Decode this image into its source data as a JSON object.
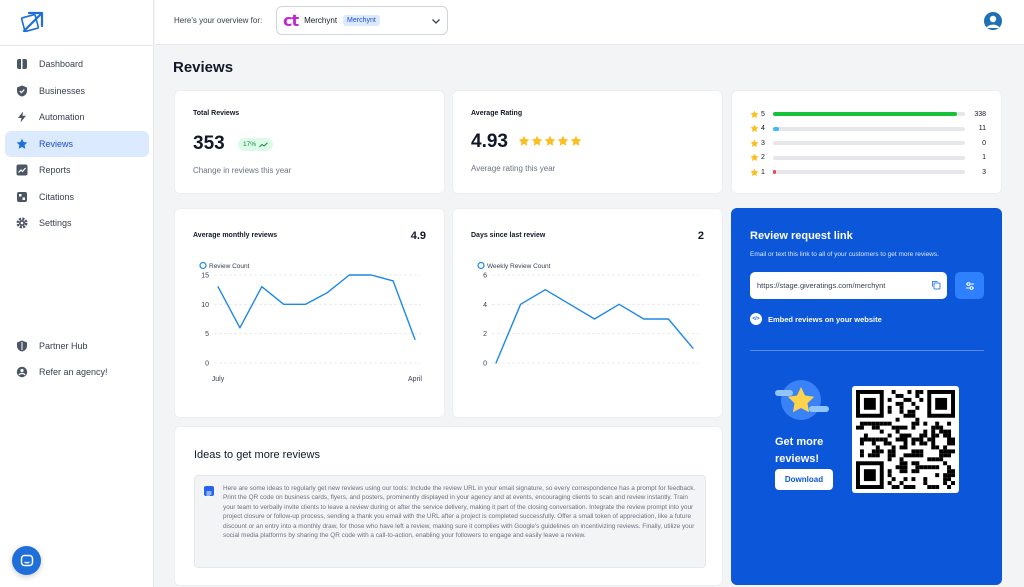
{
  "header": {
    "overview_label": "Here's your overview for:",
    "business_name": "Merchynt",
    "business_tag": "Merchynt",
    "business_logo_text": "ct"
  },
  "sidebar": {
    "items": [
      {
        "label": "Dashboard",
        "icon": "dashboard-icon"
      },
      {
        "label": "Businesses",
        "icon": "shield-check-icon"
      },
      {
        "label": "Automation",
        "icon": "bolt-icon"
      },
      {
        "label": "Reviews",
        "icon": "star-icon",
        "active": true
      },
      {
        "label": "Reports",
        "icon": "trend-icon"
      },
      {
        "label": "Citations",
        "icon": "citations-icon"
      },
      {
        "label": "Settings",
        "icon": "gear-icon"
      }
    ],
    "bottom_items": [
      {
        "label": "Partner Hub",
        "icon": "shield-icon"
      },
      {
        "label": "Refer an agency!",
        "icon": "refer-icon"
      }
    ]
  },
  "page": {
    "title": "Reviews"
  },
  "total_reviews": {
    "label": "Total Reviews",
    "value": "353",
    "change": "17%",
    "caption": "Change in reviews this year"
  },
  "average_rating": {
    "label": "Average Rating",
    "value": "4.93",
    "stars": 5,
    "caption": "Average rating this year"
  },
  "rating_breakdown": [
    {
      "stars": "5",
      "count": "338",
      "fraction": 0.96,
      "color": "#16c23a"
    },
    {
      "stars": "4",
      "count": "11",
      "fraction": 0.03,
      "color": "#38bdf8"
    },
    {
      "stars": "3",
      "count": "0",
      "fraction": 0,
      "color": "#e5e7eb"
    },
    {
      "stars": "2",
      "count": "1",
      "fraction": 0,
      "color": "#e5e7eb"
    },
    {
      "stars": "1",
      "count": "3",
      "fraction": 0.01,
      "color": "#ef4444"
    }
  ],
  "monthly_chart": {
    "title": "Average monthly reviews",
    "value": "4.9",
    "legend": "Review Count",
    "x_start": "July",
    "x_end": "April",
    "y_ticks": [
      "15",
      "10",
      "5",
      "0"
    ]
  },
  "weekly_chart": {
    "title": "Days since last review",
    "value": "2",
    "legend": "Weekly Review Count",
    "y_ticks": [
      "6",
      "4",
      "2",
      "0"
    ]
  },
  "chart_data": [
    {
      "type": "line",
      "title": "Average monthly reviews",
      "series": [
        {
          "name": "Review Count",
          "values": [
            13,
            6,
            13,
            10,
            10,
            12,
            15,
            15,
            14,
            4
          ]
        }
      ],
      "x_tick_labels": [
        "July",
        "April"
      ],
      "ylim": [
        0,
        15
      ],
      "grid": true,
      "legend": "top-left"
    },
    {
      "type": "line",
      "title": "Days since last review",
      "series": [
        {
          "name": "Weekly Review Count",
          "values": [
            0,
            4,
            5,
            4,
            3,
            4,
            3,
            3,
            1
          ]
        }
      ],
      "ylim": [
        0,
        6
      ],
      "grid": true,
      "legend": "top-left"
    }
  ],
  "review_request": {
    "title": "Review request link",
    "description": "Email or text this link to all of your customers to get more reviews.",
    "link": "https://stage.giveratings.com/merchynt",
    "embed_label": "Embed reviews on your website",
    "embed_icon_text": "</>",
    "get_more": "Get more reviews!",
    "download": "Download"
  },
  "ideas": {
    "title": "Ideas to get more reviews",
    "text": "Here are some ideas to regularly get new reviews using our tools: Include the review URL in your email signature, so every correspondence has a prompt for feedback. Print the QR code on business cards, flyers, and posters, prominently displayed in your agency and at events, encouraging clients to scan and review instantly. Train your team to verbally invite clients to leave a review during or after the service delivery, making it part of the closing conversation. Integrate the review prompt into your project closure or follow-up process, sending a thank you email with the URL after a project is completed successfully. Offer a small token of appreciation, like a future discount or an entry into a monthly draw, for those who have left a review, making sure it complies with Google's guidelines on incentivizing reviews. Finally, utilize your social media platforms by sharing the QR code with a call-to-action, enabling your followers to engage and easily leave a review."
  },
  "colors": {
    "accent": "#0b56d9",
    "star": "#fbbf24",
    "line": "#1e88e5",
    "active_nav": "#dbeafe"
  }
}
